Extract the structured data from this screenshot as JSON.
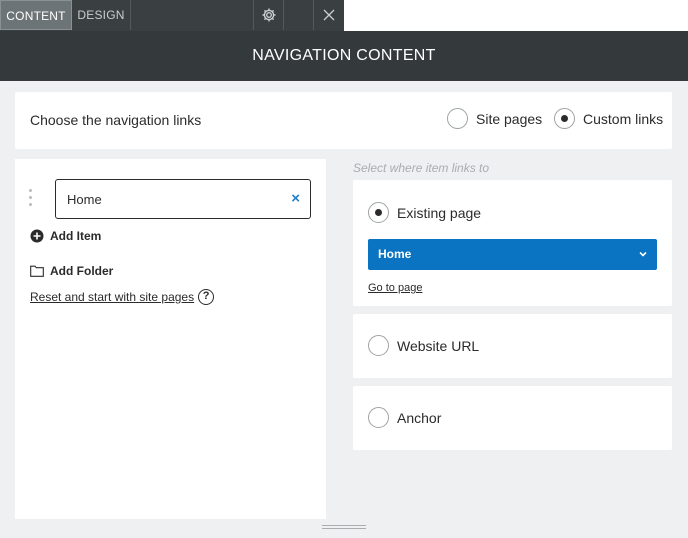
{
  "tabs": {
    "content_label": "CONTENT",
    "design_label": "DESIGN"
  },
  "icons": {
    "settings": "gear-icon",
    "close": "close-icon",
    "add": "plus-circle-icon",
    "folder": "folder-icon",
    "help": "question-circle-icon",
    "remove": "x-icon",
    "dropdown": "chevron-down-icon",
    "drag": "drag-handle-icon"
  },
  "header": {
    "title": "NAVIGATION CONTENT"
  },
  "choose": {
    "label": "Choose the navigation links",
    "options": [
      {
        "label": "Site pages",
        "selected": false
      },
      {
        "label": "Custom links",
        "selected": true
      }
    ]
  },
  "nav_items": {
    "items": [
      {
        "label": "Home",
        "remove_glyph": "×"
      }
    ],
    "add_item_label": "Add Item",
    "add_folder_label": "Add Folder",
    "reset_label": "Reset and start with site pages",
    "help_glyph": "?"
  },
  "link_target": {
    "hint": "Select where item links to",
    "existing_label": "Existing page",
    "existing_selected": true,
    "page_select_value": "Home",
    "goto_label": "Go to page",
    "url_label": "Website URL",
    "anchor_label": "Anchor"
  },
  "colors": {
    "accent": "#0a73c2",
    "header_bg": "#34393c",
    "tabbar_bg": "#3a3f42",
    "panel_bg": "#eef0f1"
  }
}
